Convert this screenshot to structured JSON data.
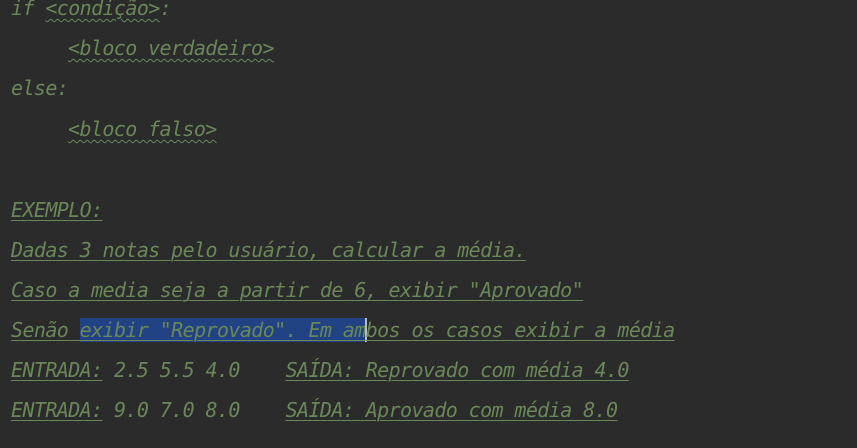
{
  "code_lines": {
    "if_kw": "if ",
    "if_cond": "<condição>",
    "if_colon": ":",
    "bloco_verdadeiro": "<bloco verdadeiro>",
    "else_kw": "else:",
    "bloco_falso": "<bloco falso>",
    "exemplo": "EXEMPLO:",
    "dadas": "Dadas 3 notas pelo usuário, calcular a média.",
    "caso": "Caso a media seja a partir de 6, exibir \"Aprovado\"",
    "senao_pre": "Senão ",
    "senao_sel_1": "exibir \"Reprovado\". Em am",
    "senao_post": "bos os casos exibir a média",
    "entrada1_label": "ENTRADA:",
    "entrada1_vals": " 2.5 5.5 4.0    ",
    "saida1_label": "SAÍDA:",
    "saida1_text": " Reprovado com média 4.0",
    "entrada2_label": "ENTRADA:",
    "entrada2_vals": " 9.0 7.0 8.0    ",
    "saida2_label": "SAÍDA:",
    "saida2_text": " Aprovado com média 8.0"
  },
  "colors": {
    "background": "#2b2b2b",
    "text": "#6a8759",
    "selection": "#214283"
  }
}
